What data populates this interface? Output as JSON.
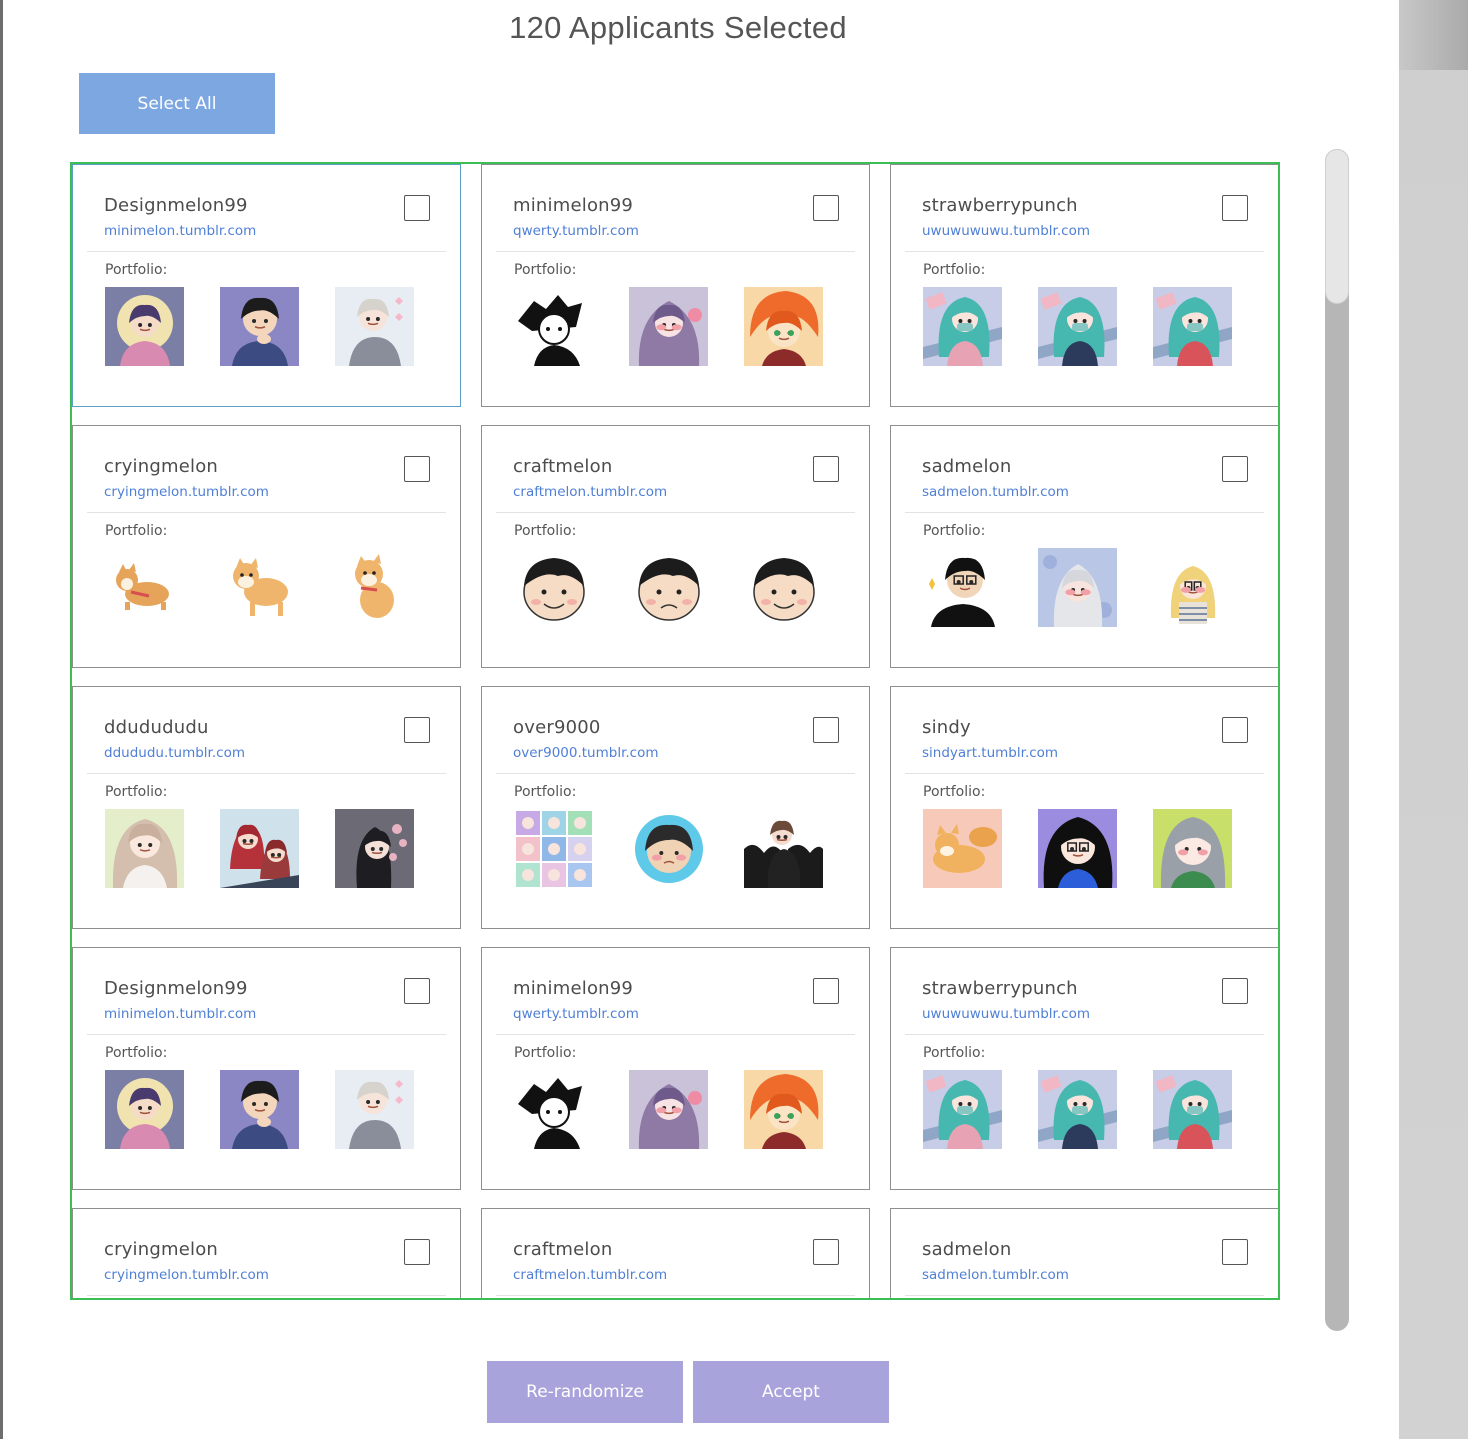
{
  "header": {
    "title": "120 Applicants Selected"
  },
  "toolbar": {
    "select_all_label": "Select All"
  },
  "footer": {
    "rerandomize_label": "Re-randomize",
    "accept_label": "Accept"
  },
  "colors": {
    "select_all_bg": "#7da7e0",
    "action_bg": "#a8a3db",
    "grid_border": "#3dbe55",
    "link": "#4f7fd6"
  },
  "portfolio_label": "Portfolio:",
  "applicants": [
    {
      "username": "Designmelon99",
      "url": "minimelon.tumblr.com",
      "checked": false,
      "portfolio": [
        "purple-girl-moon",
        "boy-thinking",
        "white-hair-girl"
      ]
    },
    {
      "username": "minimelon99",
      "url": "qwerty.tumblr.com",
      "checked": false,
      "portfolio": [
        "bw-ink-boy",
        "purple-hair-girl",
        "orange-hair-boy"
      ]
    },
    {
      "username": "strawberrypunch",
      "url": "uwuwuwuwu.tumblr.com",
      "checked": false,
      "portfolio": [
        "teal-hair-girl-pink",
        "teal-hair-girl-navy",
        "teal-hair-girl-red"
      ]
    },
    {
      "username": "cryingmelon",
      "url": "cryingmelon.tumblr.com",
      "checked": false,
      "portfolio": [
        "shiba-running",
        "shiba-standing",
        "shiba-sitting"
      ]
    },
    {
      "username": "craftmelon",
      "url": "craftmelon.tumblr.com",
      "checked": false,
      "portfolio": [
        "boy-face-smile",
        "boy-face-sad",
        "boy-face-calm"
      ]
    },
    {
      "username": "sadmelon",
      "url": "sadmelon.tumblr.com",
      "checked": false,
      "portfolio": [
        "glasses-man-sparkle",
        "silver-hair-girl",
        "blonde-glasses-girl"
      ]
    },
    {
      "username": "ddudududu",
      "url": "ddududu.tumblr.com",
      "checked": false,
      "portfolio": [
        "long-hair-girl",
        "red-hair-duo",
        "flower-girl"
      ]
    },
    {
      "username": "over9000",
      "url": "over9000.tumblr.com",
      "checked": false,
      "portfolio": [
        "character-grid",
        "round-face-avatar",
        "black-dress-girl"
      ]
    },
    {
      "username": "sindy",
      "url": "sindyart.tumblr.com",
      "checked": false,
      "portfolio": [
        "corgi-pile",
        "black-hair-glasses",
        "grey-hair-blush"
      ]
    },
    {
      "username": "Designmelon99",
      "url": "minimelon.tumblr.com",
      "checked": false,
      "portfolio": [
        "purple-girl-moon",
        "boy-thinking",
        "white-hair-girl"
      ]
    },
    {
      "username": "minimelon99",
      "url": "qwerty.tumblr.com",
      "checked": false,
      "portfolio": [
        "bw-ink-boy",
        "purple-hair-girl",
        "orange-hair-boy"
      ]
    },
    {
      "username": "strawberrypunch",
      "url": "uwuwuwuwu.tumblr.com",
      "checked": false,
      "portfolio": [
        "teal-hair-girl-pink",
        "teal-hair-girl-navy",
        "teal-hair-girl-red"
      ]
    },
    {
      "username": "cryingmelon",
      "url": "cryingmelon.tumblr.com",
      "checked": false,
      "portfolio": []
    },
    {
      "username": "craftmelon",
      "url": "craftmelon.tumblr.com",
      "checked": false,
      "portfolio": []
    },
    {
      "username": "sadmelon",
      "url": "sadmelon.tumblr.com",
      "checked": false,
      "portfolio": []
    }
  ],
  "scroll": {
    "position_fraction": 0.0,
    "visible_fraction": 0.13
  }
}
